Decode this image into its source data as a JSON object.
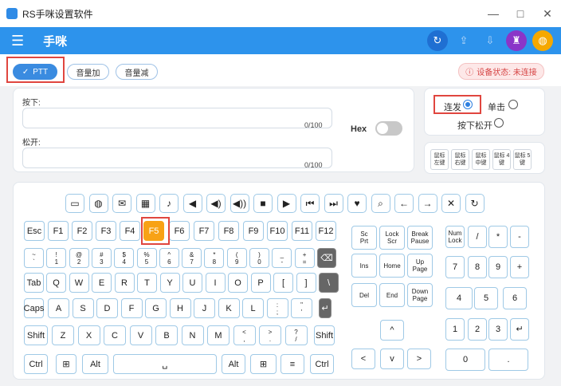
{
  "window": {
    "title": "RS手咪设置软件",
    "minimize": "—",
    "maximize": "□",
    "close": "✕"
  },
  "header": {
    "menu_icon": "☰",
    "title": "手咪",
    "buttons": {
      "refresh": "↻",
      "upload": "⇪",
      "download": "⇩",
      "clean": "♜",
      "theme": "◍"
    }
  },
  "toolbar": {
    "ptt_check": "✓",
    "ptt": "PTT",
    "vol_up": "音量加",
    "vol_down": "音量减"
  },
  "status": {
    "icon": "ⓘ",
    "text": "设备状态: 未连接"
  },
  "press": {
    "label": "按下:",
    "count": "0/100",
    "value": ""
  },
  "release": {
    "label": "松开:",
    "count": "0/100",
    "value": ""
  },
  "hex": {
    "label": "Hex",
    "on": false
  },
  "mode": {
    "repeat": "连发",
    "single": "单击",
    "press_release": "按下松开",
    "selected": "repeat"
  },
  "mouse_buttons": [
    "鼠标\n左键",
    "鼠标\n右键",
    "鼠标\n中键",
    "鼠标\n4键",
    "鼠标\n5键"
  ],
  "icon_row": [
    "▭",
    "◍",
    "✉",
    "▦",
    "♪",
    "◀",
    "◀)",
    "◀))",
    "■",
    "▶",
    "⏮",
    "⏭",
    "♥",
    "⌕",
    "←",
    "→",
    "✕",
    "↻"
  ],
  "keyboard": {
    "function_row": [
      "Esc",
      "F1",
      "F2",
      "F3",
      "F4",
      "F5",
      "F6",
      "F7",
      "F8",
      "F9",
      "F10",
      "F11",
      "F12"
    ],
    "number_row": [
      "~\n`",
      "!\n1",
      "@\n2",
      "#\n3",
      "$\n4",
      "%\n5",
      "^\n6",
      "&\n7",
      "*\n8",
      "(\n9",
      ")\n0",
      "_\n-",
      "+\n=",
      "⌫"
    ],
    "tab_row": [
      "Tab",
      "Q",
      "W",
      "E",
      "R",
      "T",
      "Y",
      "U",
      "I",
      "O",
      "P",
      "[",
      "]",
      "\\"
    ],
    "caps_row": [
      "Caps",
      "A",
      "S",
      "D",
      "F",
      "G",
      "H",
      "J",
      "K",
      "L",
      ":\n;",
      "\"\n'",
      "↵"
    ],
    "shift_row": [
      "Shift",
      "Z",
      "X",
      "C",
      "V",
      "B",
      "N",
      "M",
      "<\n,",
      ">\n.",
      "?\n/",
      "Shift"
    ],
    "bottom_row": [
      "Ctrl",
      "⊞",
      "Alt",
      "␣",
      "Alt",
      "⊞",
      "≡",
      "Ctrl"
    ],
    "nav_keys": [
      "Sc\nPrt",
      "Lock\nScr",
      "Break\nPause",
      "Ins",
      "Home",
      "Up\nPage",
      "Del",
      "End",
      "Down\nPage"
    ],
    "arrows": {
      "up": "^",
      "left": "<",
      "down": "v",
      "right": ">"
    },
    "numpad": [
      "Num\nLock",
      "/",
      "*",
      "-",
      "7",
      "8",
      "9",
      "+",
      "4",
      "5",
      "6",
      "1",
      "2",
      "3",
      "↵",
      "0",
      "."
    ]
  },
  "colors": {
    "accent": "#2d93ec",
    "highlight": "#f8a215",
    "alert": "#d64545"
  }
}
